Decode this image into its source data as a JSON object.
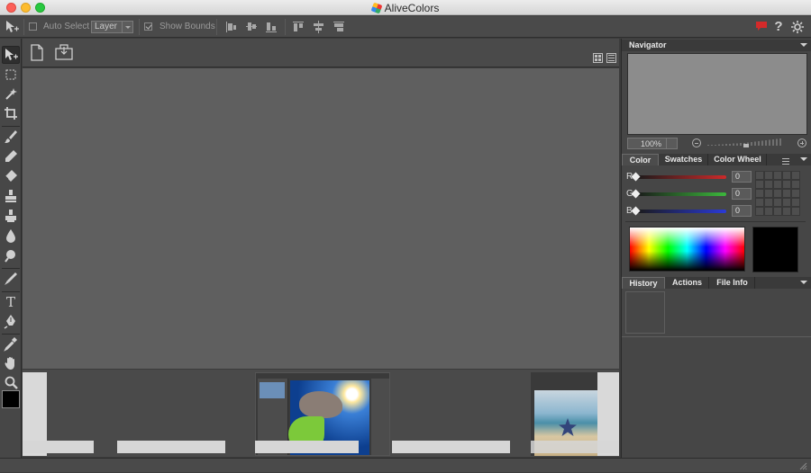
{
  "window": {
    "title": "AliveColors"
  },
  "options_bar": {
    "auto_select_label": "Auto Select",
    "auto_select_checked": false,
    "select_target_value": "Layer",
    "show_bounds_label": "Show Bounds",
    "show_bounds_checked": true
  },
  "toolbar": {
    "tools": [
      {
        "name": "move-tool-icon",
        "glyph": "✥"
      },
      {
        "name": "marquee-tool-icon",
        "glyph": "⬚"
      },
      {
        "name": "magic-wand-tool-icon",
        "glyph": "✷"
      },
      {
        "name": "crop-tool-icon",
        "glyph": "⌗"
      },
      {
        "name": "brush-tool-icon",
        "glyph": "✎"
      },
      {
        "name": "eraser-tool-icon",
        "glyph": "▰"
      },
      {
        "name": "fill-tool-icon",
        "glyph": "◈"
      },
      {
        "name": "stamp-tool-icon",
        "glyph": "⊥"
      },
      {
        "name": "healing-tool-icon",
        "glyph": "⊤"
      },
      {
        "name": "blur-tool-icon",
        "glyph": "●"
      },
      {
        "name": "dodge-tool-icon",
        "glyph": "⚲"
      },
      {
        "name": "smudge-tool-icon",
        "glyph": "✐"
      },
      {
        "name": "text-tool-icon",
        "glyph": "T"
      },
      {
        "name": "pen-tool-icon",
        "glyph": "✒"
      },
      {
        "name": "eyedropper-tool-icon",
        "glyph": "⁄"
      },
      {
        "name": "hand-tool-icon",
        "glyph": "✋"
      },
      {
        "name": "zoom-tool-icon",
        "glyph": "⚲"
      }
    ],
    "foreground_color": "#000000"
  },
  "navigator": {
    "title": "Navigator",
    "zoom_value": "100%"
  },
  "color_panel": {
    "tabs": [
      "Color",
      "Swatches",
      "Color Wheel"
    ],
    "active_tab": "Color",
    "channels": [
      {
        "label": "R",
        "value": "0",
        "color": "#cc2a2a"
      },
      {
        "label": "G",
        "value": "0",
        "color": "#3cb83c"
      },
      {
        "label": "B",
        "value": "0",
        "color": "#2a3ad8"
      }
    ],
    "current_color": "#000000"
  },
  "history_panel": {
    "tabs": [
      "History",
      "Actions",
      "File Info"
    ],
    "active_tab": "History"
  },
  "colors": {
    "alert_red": "#d42a2a",
    "canvas_gray": "#5f5f5f"
  }
}
